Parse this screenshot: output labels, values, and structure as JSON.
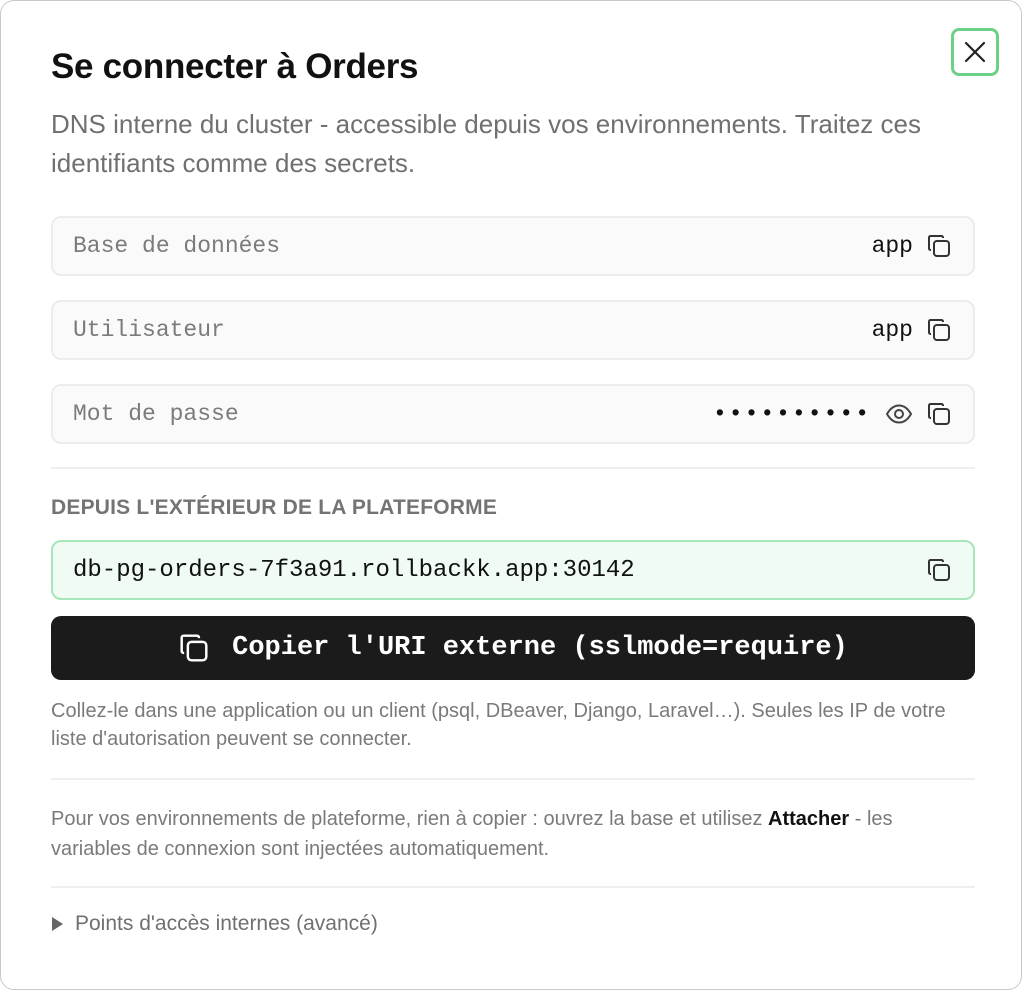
{
  "dialog": {
    "title": "Se connecter à Orders",
    "subtitle": "DNS interne du cluster - accessible depuis vos environnements. Traitez ces identifiants comme des secrets.",
    "close_icon": "close-icon"
  },
  "fields": [
    {
      "label": "Base de données",
      "value": "app",
      "icon": "copy-icon"
    },
    {
      "label": "Utilisateur",
      "value": "app",
      "icon": "copy-icon"
    },
    {
      "label": "Mot de passe",
      "value": "••••••••••",
      "icons": [
        "eye-icon",
        "copy-icon"
      ]
    }
  ],
  "external": {
    "heading": "DEPUIS L'EXTÉRIEUR DE LA PLATEFORME",
    "host": "db-pg-orders-7f3a91.rollbackk.app:30142",
    "copy_uri_label": "Copier l'URI externe (sslmode=require)",
    "help": "Collez-le dans une application ou un client (psql, DBeaver, Django, Laravel…). Seules les IP de votre liste d'autorisation peuvent se connecter."
  },
  "platform": {
    "text_before": "Pour vos environnements de plateforme, rien à copier : ouvrez la base et utilisez ",
    "strong": "Attacher",
    "text_after": " - les variables de connexion sont injectées automatiquement."
  },
  "advanced": {
    "label": "Points d'accès internes (avancé)",
    "icon": "triangle-right-icon"
  },
  "colors": {
    "accent_green_border": "#6ecf86",
    "external_field_bg": "#f0fbf3",
    "external_field_border": "#a7e6b8",
    "primary_button_bg": "#1b1b1b"
  }
}
